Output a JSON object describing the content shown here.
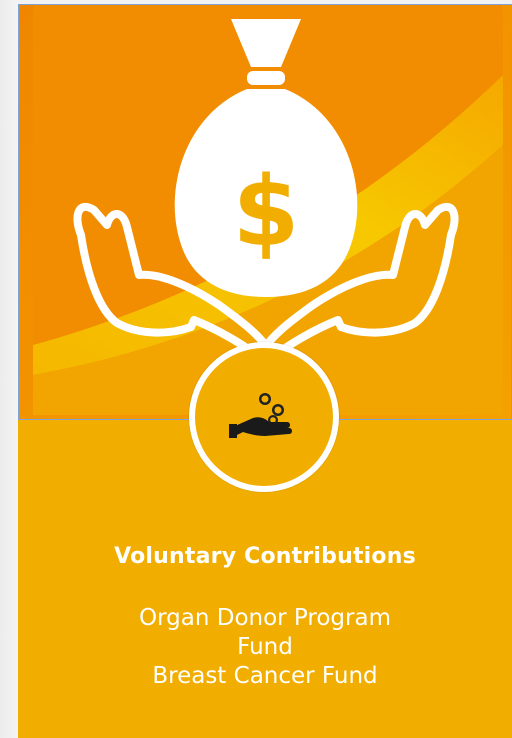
{
  "card": {
    "title": "Voluntary Contributions",
    "funds": [
      {
        "label": "Organ Donor Program Fund"
      },
      {
        "label": "Breast Cancer Fund"
      }
    ],
    "hero_icon": "money-bag-hands-icon",
    "badge_icon": "donation-hand-coins-icon",
    "badge_caption": "",
    "colors": {
      "card_background": "#f2ae00",
      "hero_orange": "#f08400",
      "hero_yellow": "#f5c400",
      "text": "#ffffff"
    }
  }
}
